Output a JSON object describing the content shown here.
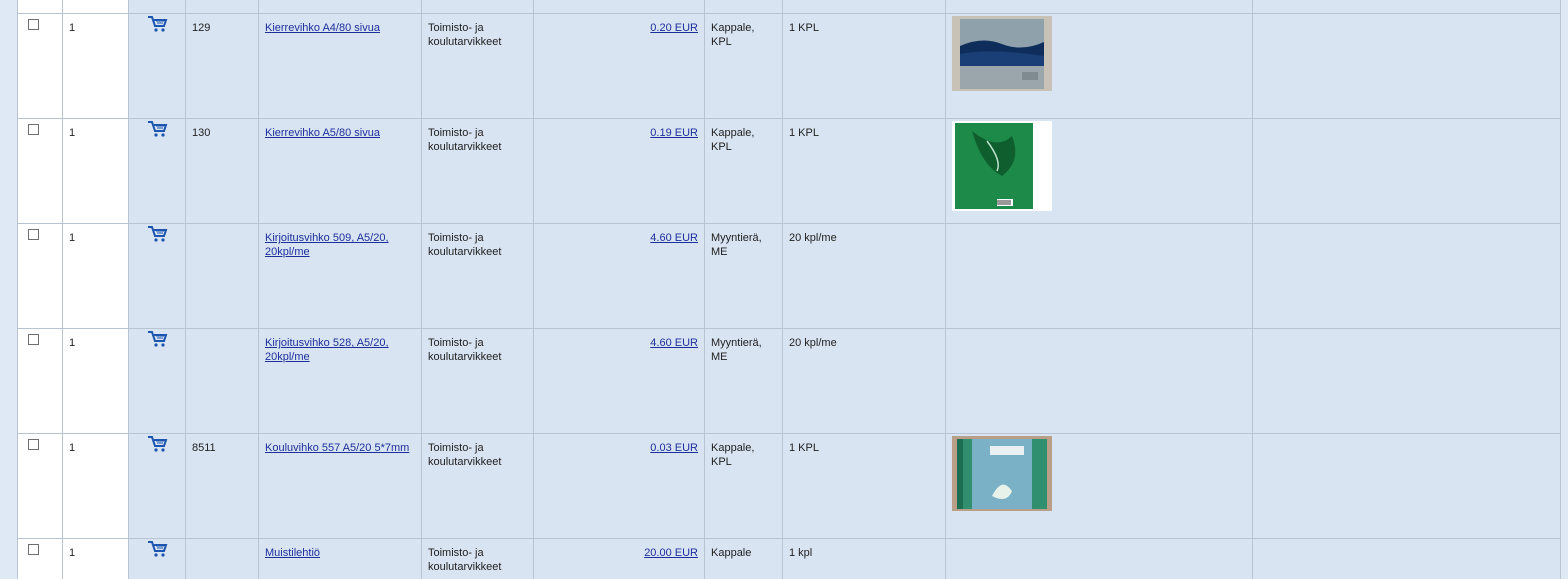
{
  "products": [
    {
      "qty": "1",
      "code": "129",
      "name": "Kierrevihko A4/80 sivua",
      "category": "Toimisto- ja koulutarvikkeet",
      "price": "0.20 EUR",
      "unit": "Kappale, KPL",
      "package": "1 KPL",
      "image": "blue-notebook"
    },
    {
      "qty": "1",
      "code": "130",
      "name": "Kierrevihko A5/80 sivua",
      "category": "Toimisto- ja koulutarvikkeet",
      "price": "0.19 EUR",
      "unit": "Kappale, KPL",
      "package": "1 KPL",
      "image": "green-notebook"
    },
    {
      "qty": "1",
      "code": "",
      "name": "Kirjoitusvihko 509, A5/20, 20kpl/me",
      "category": "Toimisto- ja koulutarvikkeet",
      "price": "4.60 EUR",
      "unit": "Myyntierä, ME",
      "package": "20 kpl/me",
      "image": ""
    },
    {
      "qty": "1",
      "code": "",
      "name": "Kirjoitusvihko 528, A5/20, 20kpl/me",
      "category": "Toimisto- ja koulutarvikkeet",
      "price": "4.60 EUR",
      "unit": "Myyntierä, ME",
      "package": "20 kpl/me",
      "image": ""
    },
    {
      "qty": "1",
      "code": "8511",
      "name": "Kouluvihko 557 A5/20 5*7mm",
      "category": "Toimisto- ja koulutarvikkeet",
      "price": "0.03 EUR",
      "unit": "Kappale, KPL",
      "package": "1 KPL",
      "image": "school-notebook"
    },
    {
      "qty": "1",
      "code": "",
      "name": "Muistilehtiö",
      "category": "Toimisto- ja koulutarvikkeet",
      "price": "20.00 EUR",
      "unit": "Kappale",
      "package": "1 kpl",
      "image": ""
    }
  ],
  "icons": {
    "cart": "shopping-cart-icon",
    "checkbox": "checkbox"
  },
  "colors": {
    "row_bg": "#d9e4f2",
    "white_col": "#ffffff",
    "link": "#1d2f9c",
    "border": "#b9c4d2"
  }
}
